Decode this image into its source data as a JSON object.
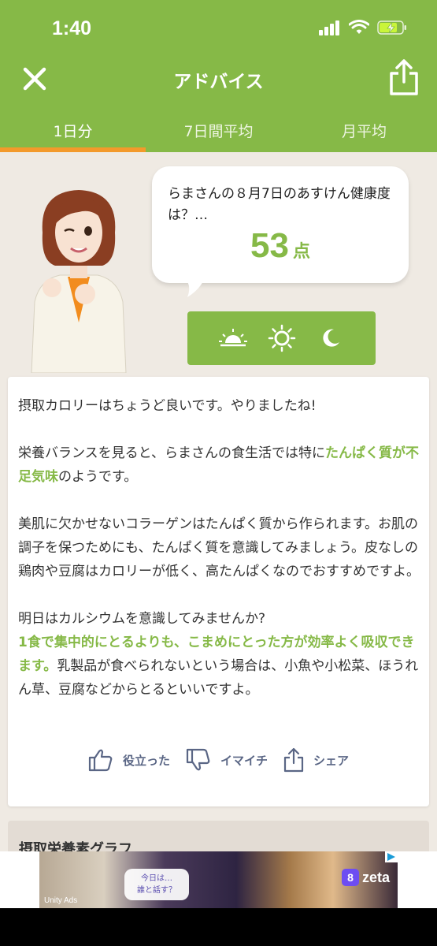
{
  "status": {
    "time": "1:40"
  },
  "header": {
    "title": "アドバイス",
    "close_icon": "close-icon",
    "share_icon": "share-icon"
  },
  "tabs": [
    {
      "label": "1日分",
      "active": true
    },
    {
      "label": "7日間平均",
      "active": false
    },
    {
      "label": "月平均",
      "active": false
    }
  ],
  "bubble": {
    "text": "らまさんの８月7日のあすけん健康度は？…",
    "score": "53",
    "unit": "点"
  },
  "time_toggle": [
    "sunrise-icon",
    "sun-icon",
    "moon-icon"
  ],
  "advice": {
    "p1": "摂取カロリーはちょうど良いです。やりましたね!",
    "p2_before": "栄養バランスを見ると、らまさんの食生活では特に",
    "p2_highlight": "たんぱく質が不足気味",
    "p2_after": "のようです。",
    "p3": "美肌に欠かせないコラーゲンはたんぱく質から作られます。お肌の調子を保つためにも、たんぱく質を意識してみましょう。皮なしの鶏肉や豆腐はカロリーが低く、高たんぱくなのでおすすめですよ。",
    "p4_line1": "明日はカルシウムを意識してみませんか?",
    "p4_highlight": "1食で集中的にとるよりも、こまめにとった方が効率よく吸収できます。",
    "p4_after": "乳製品が食べられないという場合は、小魚や小松菜、ほうれん草、豆腐などからとるといいですよ。"
  },
  "actions": {
    "like": "役立った",
    "dislike": "イマイチ",
    "share": "シェア"
  },
  "graph": {
    "title": "摂取栄養素グラフ"
  },
  "ad": {
    "speech": "今日は…\n誰と話す？",
    "brand": "zeta",
    "unity": "Unity Ads"
  },
  "colors": {
    "green": "#86b947",
    "orange": "#f39a2b",
    "bg": "#efeae3"
  }
}
